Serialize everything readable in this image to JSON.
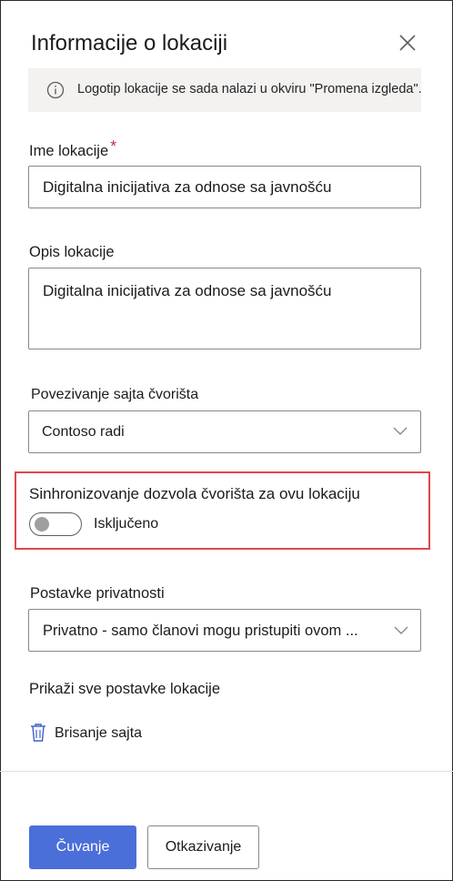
{
  "panel": {
    "title": "Informacije o lokaciji"
  },
  "info_bar": {
    "text": "Logotip lokacije se sada nalazi u okviru \"Promena izgleda\"."
  },
  "site_name": {
    "label": "Ime lokacije",
    "required_marker": "*",
    "value": "Digitalna inicijativa za odnose sa javnošću"
  },
  "site_description": {
    "label": "Opis lokacije",
    "value": "Digitalna inicijativa za odnose sa javnošću"
  },
  "hub_association": {
    "label": "Povezivanje sajta čvorišta",
    "selected": "Contoso radi"
  },
  "sync_permissions": {
    "label": "Sinhronizovanje dozvola čvorišta za ovu lokaciju",
    "state_label": "Isključeno",
    "enabled": false
  },
  "privacy": {
    "label": "Postavke privatnosti",
    "selected": "Privatno - samo članovi mogu pristupiti ovom ..."
  },
  "links": {
    "view_all": "Prikaži sve postavke lokacije",
    "delete_site": "Brisanje sajta"
  },
  "footer": {
    "save": "Čuvanje",
    "cancel": "Otkazivanje"
  },
  "colors": {
    "primary": "#4a6fd9",
    "highlight": "#e0474c",
    "required": "#c4314b",
    "info_bar_bg": "#f3f2f1"
  },
  "icons": [
    "close-icon",
    "info-icon",
    "chevron-down-icon",
    "trash-icon"
  ]
}
